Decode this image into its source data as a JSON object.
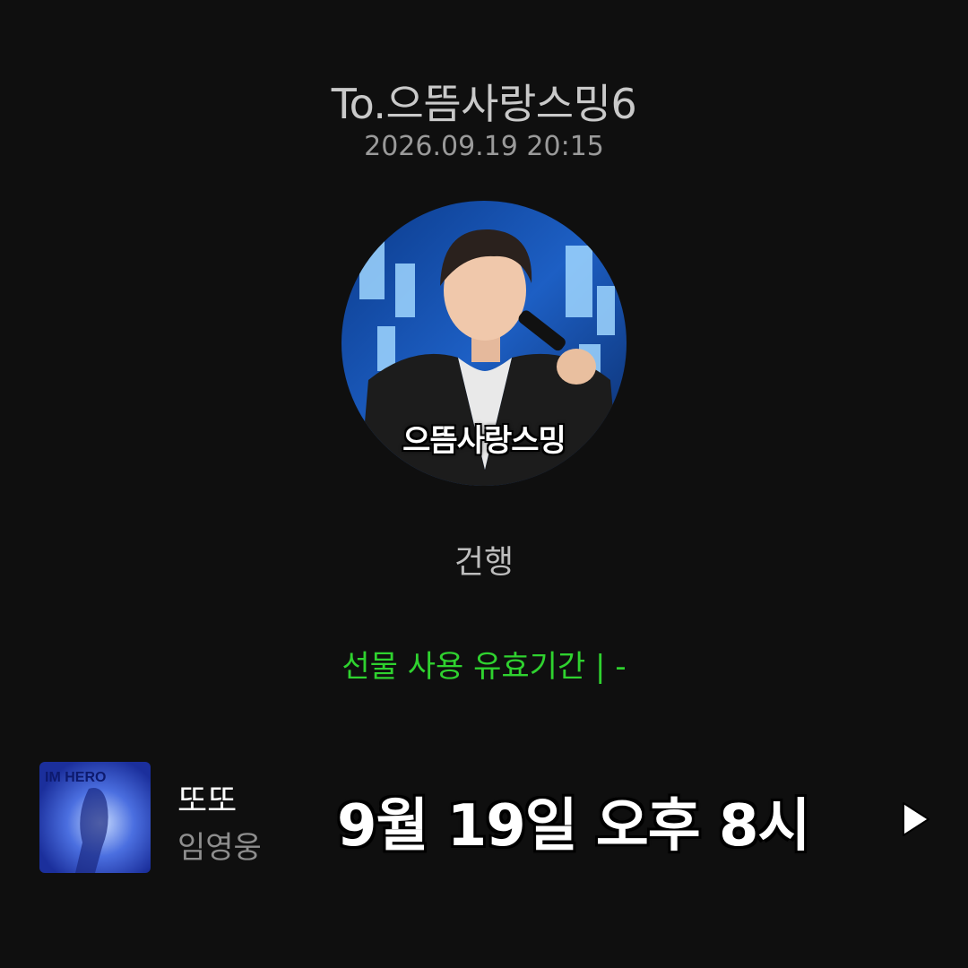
{
  "gift": {
    "recipient": "To.으뜸사랑스밍6",
    "timestamp": "2026.09.19 20:15",
    "profile": {
      "caption": "으뜸사랑스밍",
      "icon": "profile-photo"
    },
    "message": "건행",
    "validity": "선물 사용 유효기간 |   -"
  },
  "player": {
    "song_title": "또또",
    "artist": "임영웅",
    "album_art_text": "IM HERO",
    "overlay_text": "9월 19일 오후 8시",
    "play_icon": "play-icon"
  },
  "colors": {
    "background": "#0f0f0f",
    "accent_green": "#2fd22f"
  }
}
